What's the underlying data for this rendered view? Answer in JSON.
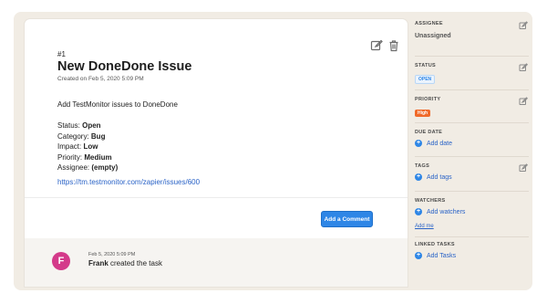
{
  "issue": {
    "number": "#1",
    "title": "New DoneDone Issue",
    "created": "Created on Feb 5, 2020 5:09 PM",
    "description": "Add TestMonitor issues to DoneDone",
    "fields": [
      {
        "label": "Status: ",
        "value": "Open"
      },
      {
        "label": "Category: ",
        "value": "Bug"
      },
      {
        "label": "Impact: ",
        "value": "Low"
      },
      {
        "label": "Priority: ",
        "value": "Medium"
      },
      {
        "label": "Assignee: ",
        "value": "(empty)"
      }
    ],
    "link": "https://tm.testmonitor.com/zapier/issues/600"
  },
  "actions": {
    "comment_label": "Add a Comment",
    "edit_icon": "pencil-icon",
    "delete_icon": "trash-icon"
  },
  "activity": {
    "avatar_initial": "F",
    "time": "Feb 5, 2020 5:09 PM",
    "user": "Frank",
    "text": " created the task",
    "avatar_color": "#d43a8a"
  },
  "sidebar": {
    "assignee": {
      "label": "ASSIGNEE",
      "value": "Unassigned"
    },
    "status": {
      "label": "STATUS",
      "value": "OPEN"
    },
    "priority": {
      "label": "PRIORITY",
      "value": "High"
    },
    "due_date": {
      "label": "DUE DATE",
      "action": "Add date"
    },
    "tags": {
      "label": "TAGS",
      "action": "Add tags"
    },
    "watchers": {
      "label": "WATCHERS",
      "action": "Add watchers",
      "secondary": "Add me"
    },
    "linked_tasks": {
      "label": "LINKED TASKS",
      "action": "Add Tasks"
    }
  },
  "colors": {
    "accent": "#2e86e6",
    "priority_high": "#f06a2a",
    "panel_background": "#f1ece4"
  }
}
